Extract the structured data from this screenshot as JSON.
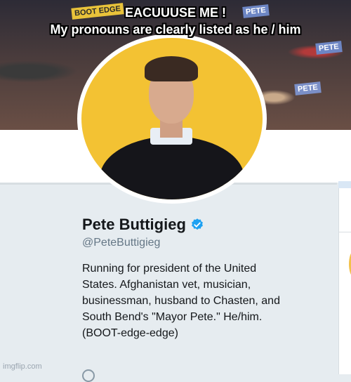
{
  "meme": {
    "caption_line1": "EACUUUSE ME !",
    "caption_line2": "My pronouns are clearly listed as he / him"
  },
  "banner": {
    "sign_yellow": "BOOT EDGE",
    "sign_blue1": "PETE",
    "sign_blue2": "PETE",
    "sign_blue3": "PETE"
  },
  "profile": {
    "name": "Pete Buttigieg",
    "handle": "@PeteButtigieg",
    "bio": "Running for president of the United\nStates. Afghanistan vet, musician,\nbusinessman, husband to Chasten, and\nSouth Bend's \"Mayor Pete.\" He/him.\n(BOOT-edge-edge)",
    "verified_icon": "verified-badge-icon"
  },
  "watermark": "imgflip.com",
  "colors": {
    "verified_blue": "#1da1f2",
    "banner_yellow": "#f3c233",
    "bg": "#e6ecf0"
  }
}
